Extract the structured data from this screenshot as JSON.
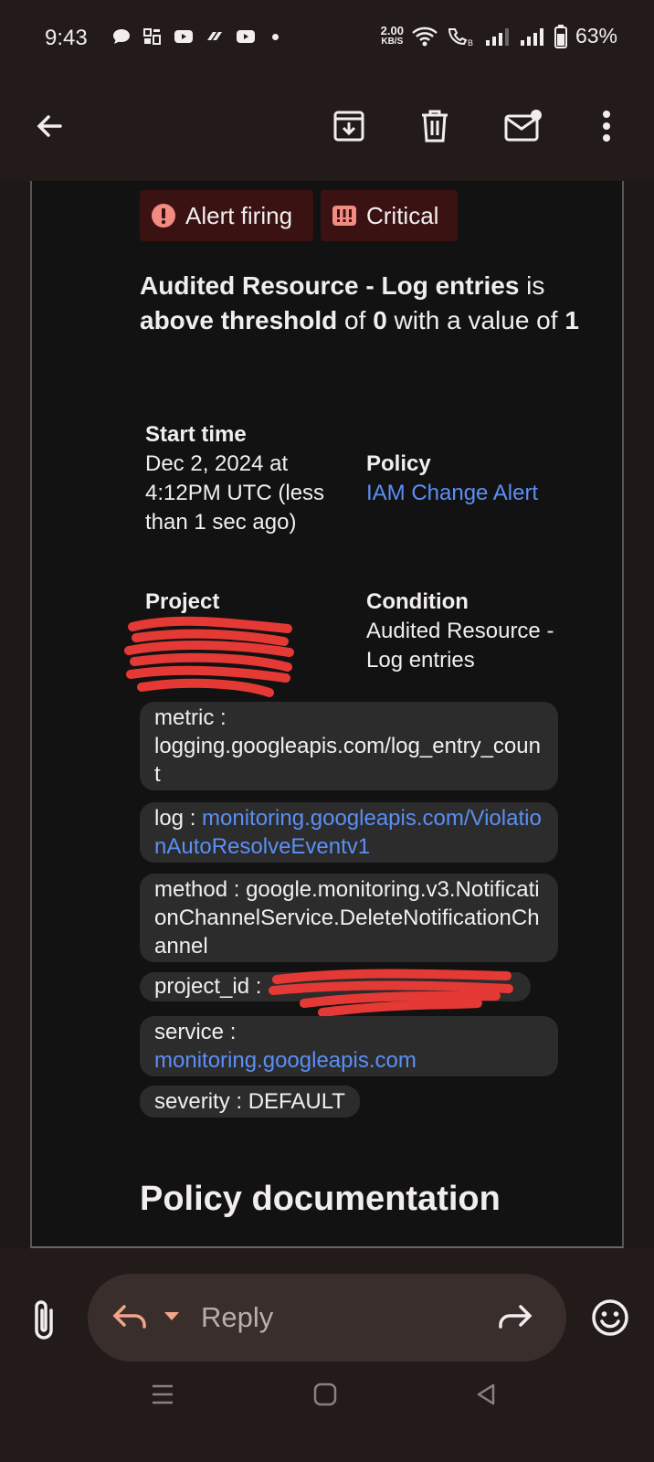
{
  "status_bar": {
    "time": "9:43",
    "speed_value": "2.00",
    "speed_unit": "KB/S",
    "battery": "63%"
  },
  "email": {
    "badges": {
      "alert": "Alert firing",
      "severity": "Critical"
    },
    "headline": {
      "part1": "Audited Resource - Log entries",
      "part2": " is ",
      "part3": "above threshold",
      "part4": " of ",
      "part5": "0",
      "part6": " with a value of ",
      "part7": "1"
    },
    "start_time": {
      "label": "Start time",
      "value": "Dec 2, 2024 at 4:12PM UTC (less than 1 sec ago)"
    },
    "policy": {
      "label": "Policy",
      "value": "IAM Change Alert"
    },
    "project": {
      "label": "Project"
    },
    "condition": {
      "label": "Condition",
      "value": "Audited Resource - Log entries"
    },
    "labels": {
      "metric_key": "metric : ",
      "metric_value": "logging.googleapis.com/log_entry_count",
      "log_key": "log : ",
      "log_value": "monitoring.googleapis.com/ViolationAutoResolveEventv1",
      "method_key": "method : ",
      "method_value": "google.monitoring.v3.NotificationChannelService.DeleteNotificationChannel",
      "project_id_key": "project_id : ",
      "service_key": "service : ",
      "service_value": "monitoring.googleapis.com",
      "severity_key": "severity : ",
      "severity_value": "DEFAULT"
    },
    "section_heading": "Policy documentation"
  },
  "reply_bar": {
    "reply_label": "Reply"
  },
  "colors": {
    "background": "#231b1a",
    "card": "#121212",
    "link": "#5b8ff5",
    "badge_bg": "#3a1212",
    "alert_red": "#f28b82",
    "redaction": "#e53935"
  }
}
